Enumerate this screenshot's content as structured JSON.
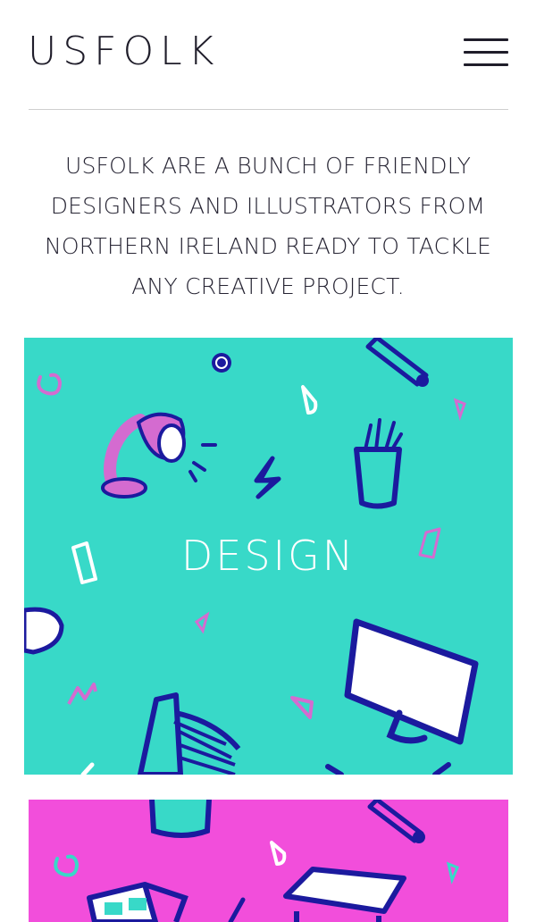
{
  "header": {
    "logo": "USFOLK",
    "menu_icon": "hamburger-menu-icon"
  },
  "intro": {
    "text": "USFOLK ARE A BUNCH OF FRIENDLY DESIGNERS AND ILLUSTRATORS FROM NORTHERN IRELAND READY TO TACKLE ANY CREATIVE PROJECT."
  },
  "cards": [
    {
      "title": "DESIGN",
      "color": "#38d9c8",
      "icons": [
        "desk-lamp-icon",
        "pencil-cup-icon",
        "monitor-icon",
        "color-swatch-icon",
        "lightning-icon",
        "pencil-icon"
      ]
    },
    {
      "title": "",
      "color": "#f24edb",
      "icons": [
        "3d-glasses-icon",
        "drawing-table-icon",
        "pencil-icon",
        "lightning-icon"
      ]
    }
  ],
  "colors": {
    "text": "#1f1d2a",
    "teal": "#38d9c8",
    "pink": "#f24edb",
    "navy": "#1b1a9e",
    "magenta": "#d46bd0"
  }
}
